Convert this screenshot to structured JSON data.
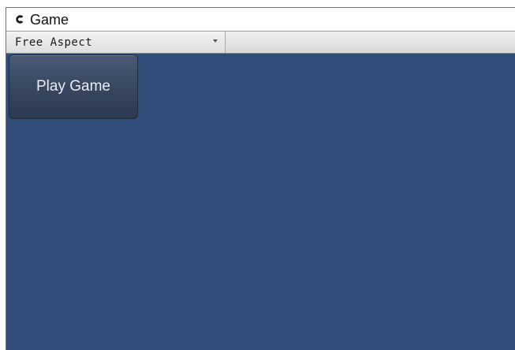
{
  "window": {
    "tab_title": "Game",
    "tab_icon": "game-view-icon"
  },
  "toolbar": {
    "aspect_selected": "Free Aspect",
    "aspect_arrow_icon": "dropdown-arrow-icon"
  },
  "viewport": {
    "background_color": "#314d79",
    "play_button_label": "Play Game"
  }
}
